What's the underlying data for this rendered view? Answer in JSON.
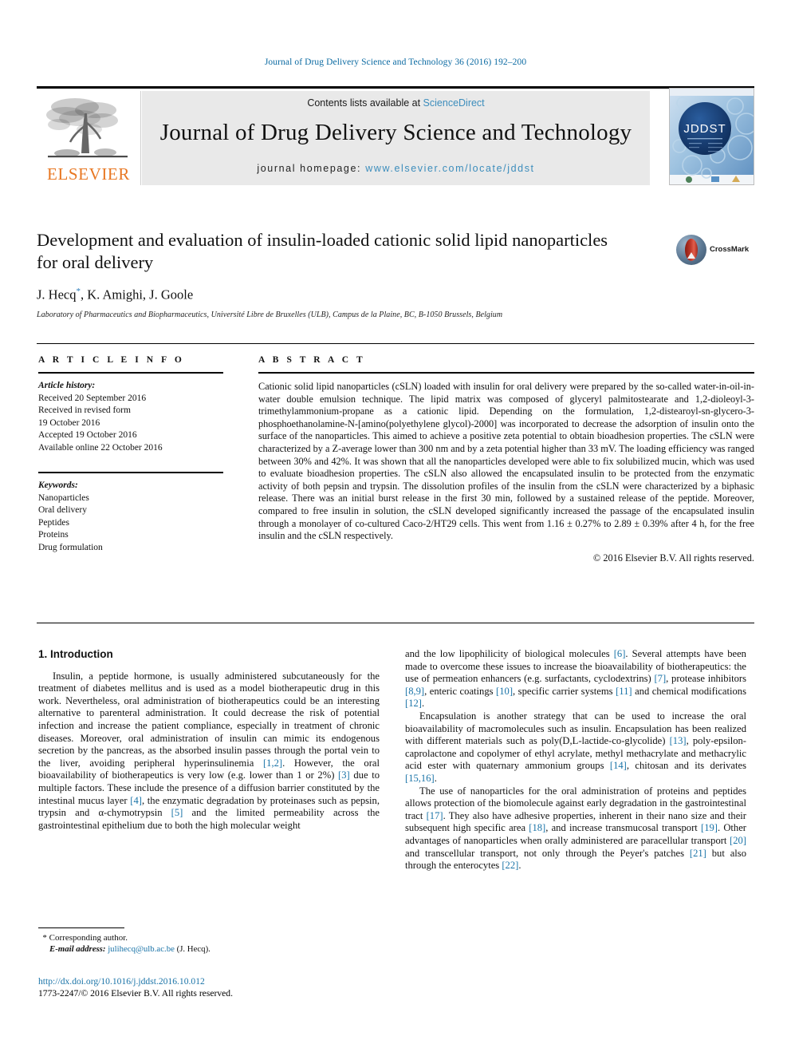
{
  "running_head": "Journal of Drug Delivery Science and Technology 36 (2016) 192–200",
  "masthead": {
    "publisher": "ELSEVIER",
    "contents_prefix": "Contents lists available at ",
    "contents_link": "ScienceDirect",
    "journal_title": "Journal of Drug Delivery Science and Technology",
    "homepage_label": "journal homepage:",
    "homepage_url": "www.elsevier.com/locate/jddst",
    "cover_title": "JDDST"
  },
  "crossmark": {
    "label": "CrossMark"
  },
  "title_block": {
    "title": "Development and evaluation of insulin-loaded cationic solid lipid nanoparticles for oral delivery",
    "authors_prefix": "J. Hecq",
    "authors_suffix": ", K. Amighi, J. Goole",
    "affiliation": "Laboratory of Pharmaceutics and Biopharmaceutics, Université Libre de Bruxelles (ULB), Campus de la Plaine, BC, B-1050 Brussels, Belgium"
  },
  "article_info": {
    "heading": "A R T I C L E  I N F O",
    "history_label": "Article history:",
    "history": [
      "Received 20 September 2016",
      "Received in revised form",
      "19 October 2016",
      "Accepted 19 October 2016",
      "Available online 22 October 2016"
    ],
    "keywords_label": "Keywords:",
    "keywords": [
      "Nanoparticles",
      "Oral delivery",
      "Peptides",
      "Proteins",
      "Drug formulation"
    ]
  },
  "abstract": {
    "heading": "A B S T R A C T",
    "text": "Cationic solid lipid nanoparticles (cSLN) loaded with insulin for oral delivery were prepared by the so-called water-in-oil-in-water double emulsion technique. The lipid matrix was composed of glyceryl palmitostearate and 1,2-dioleoyl-3-trimethylammonium-propane as a cationic lipid. Depending on the formulation, 1,2-distearoyl-sn-glycero-3-phosphoethanolamine-N-[amino(polyethylene glycol)-2000] was incorporated to decrease the adsorption of insulin onto the surface of the nanoparticles. This aimed to achieve a positive zeta potential to obtain bioadhesion properties. The cSLN were characterized by a Z-average lower than 300 nm and by a zeta potential higher than 33 mV. The loading efficiency was ranged between 30% and 42%. It was shown that all the nanoparticles developed were able to fix solubilized mucin, which was used to evaluate bioadhesion properties. The cSLN also allowed the encapsulated insulin to be protected from the enzymatic activity of both pepsin and trypsin. The dissolution profiles of the insulin from the cSLN were characterized by a biphasic release. There was an initial burst release in the first 30 min, followed by a sustained release of the peptide. Moreover, compared to free insulin in solution, the cSLN developed significantly increased the passage of the encapsulated insulin through a monolayer of co-cultured Caco-2/HT29 cells. This went from 1.16 ± 0.27% to 2.89 ± 0.39% after 4 h, for the free insulin and the cSLN respectively.",
    "copyright": "© 2016 Elsevier B.V. All rights reserved."
  },
  "introduction": {
    "section_title": "1. Introduction",
    "paragraph_1_a": "Insulin, a peptide hormone, is usually administered subcutaneously for the treatment of diabetes mellitus and is used as a model biotherapeutic drug in this work. Nevertheless, oral administration of biotherapeutics could be an interesting alternative to parenteral administration. It could decrease the risk of potential infection and increase the patient compliance, especially in treatment of chronic diseases. Moreover, oral administration of insulin can mimic its endogenous secretion by the pancreas, as the absorbed insulin passes through the portal vein to the liver, avoiding peripheral hyperinsulinemia ",
    "ref_1_2": "[1,2]",
    "paragraph_1_b": ". However, the oral bioavailability of biotherapeutics is very low (e.g. lower than 1 or 2%) ",
    "ref_3": "[3]",
    "paragraph_1_c": " due to multiple factors. These include the presence of a diffusion barrier constituted by the intestinal mucus layer ",
    "ref_4": "[4]",
    "paragraph_1_d": ", the enzymatic degradation by proteinases such as pepsin, trypsin and α-chymotrypsin ",
    "ref_5": "[5]",
    "paragraph_1_e": " and the limited permeability across the gastrointestinal epithelium due to both the high molecular weight and the low lipophilicity of biological molecules ",
    "ref_6": "[6]",
    "paragraph_1_f": ". Several attempts have been made to overcome these issues to increase the bioavailability of biotherapeutics: the use of permeation enhancers (e.g. surfactants, cyclodextrins) ",
    "ref_7": "[7]",
    "paragraph_1_g": ", protease inhibitors ",
    "ref_8_9": "[8,9]",
    "paragraph_1_h": ", enteric coatings ",
    "ref_10": "[10]",
    "paragraph_1_i": ", specific carrier systems ",
    "ref_11": "[11]",
    "paragraph_1_j": " and chemical modifications ",
    "ref_12": "[12]",
    "paragraph_1_k": ".",
    "paragraph_2_a": "Encapsulation is another strategy that can be used to increase the oral bioavailability of macromolecules such as insulin. Encapsulation has been realized with different materials such as poly(D,L-lactide-co-glycolide) ",
    "ref_13": "[13]",
    "paragraph_2_b": ", poly-epsilon-caprolactone and copolymer of ethyl acrylate, methyl methacrylate and methacrylic acid ester with quaternary ammonium groups ",
    "ref_14": "[14]",
    "paragraph_2_c": ", chitosan and its derivates ",
    "ref_15_16": "[15,16]",
    "paragraph_2_d": ".",
    "paragraph_3_a": "The use of nanoparticles for the oral administration of proteins and peptides allows protection of the biomolecule against early degradation in the gastrointestinal tract ",
    "ref_17": "[17]",
    "paragraph_3_b": ". They also have adhesive properties, inherent in their nano size and their subsequent high specific area ",
    "ref_18": "[18]",
    "paragraph_3_c": ", and increase transmucosal transport ",
    "ref_19": "[19]",
    "paragraph_3_d": ". Other advantages of nanoparticles when orally administered are paracellular transport ",
    "ref_20": "[20]",
    "paragraph_3_e": " and transcellular transport, not only through the Peyer's patches ",
    "ref_21": "[21]",
    "paragraph_3_f": " but also through the enterocytes ",
    "ref_22": "[22]",
    "paragraph_3_g": "."
  },
  "footnote": {
    "corresponding": "* Corresponding author.",
    "email_label": "E-mail address:",
    "email": "julihecq@ulb.ac.be",
    "email_owner": "(J. Hecq)."
  },
  "footer": {
    "doi": "http://dx.doi.org/10.1016/j.jddst.2016.10.012",
    "issn_line": "1773-2247/© 2016 Elsevier B.V. All rights reserved."
  },
  "colors": {
    "link_blue": "#1b74a8",
    "elsevier_orange": "#E87722",
    "panel_grey": "#e9e9e9"
  }
}
